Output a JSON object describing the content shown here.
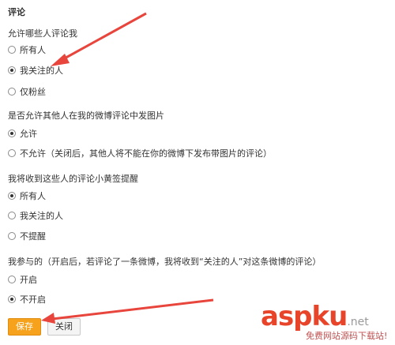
{
  "colors": {
    "accent": "#f7a21c",
    "arrow": "#e8453c",
    "watermark": "#e8442a"
  },
  "section_title": "评论",
  "groups": [
    {
      "label": "允许哪些人评论我",
      "options": [
        {
          "label": "所有人",
          "checked": false
        },
        {
          "label": "我关注的人",
          "checked": true
        },
        {
          "label": "仅粉丝",
          "checked": false
        }
      ]
    },
    {
      "label": "是否允许其他人在我的微博评论中发图片",
      "options": [
        {
          "label": "允许",
          "checked": true
        },
        {
          "label": "不允许（关闭后，其他人将不能在你的微博下发布带图片的评论）",
          "checked": false
        }
      ]
    },
    {
      "label": "我将收到这些人的评论小黄签提醒",
      "options": [
        {
          "label": "所有人",
          "checked": true
        },
        {
          "label": "我关注的人",
          "checked": false
        },
        {
          "label": "不提醒",
          "checked": false
        }
      ]
    },
    {
      "label": "我参与的（开启后，若评论了一条微博，我将收到“关注的人”对这条微博的评论）",
      "options": [
        {
          "label": "开启",
          "checked": false
        },
        {
          "label": "不开启",
          "checked": true
        }
      ]
    }
  ],
  "buttons": {
    "save": "保存",
    "close": "关闭"
  },
  "watermark": {
    "main": "aspku",
    "suffix": ".net",
    "sub": "免费网站源码下载站!"
  }
}
